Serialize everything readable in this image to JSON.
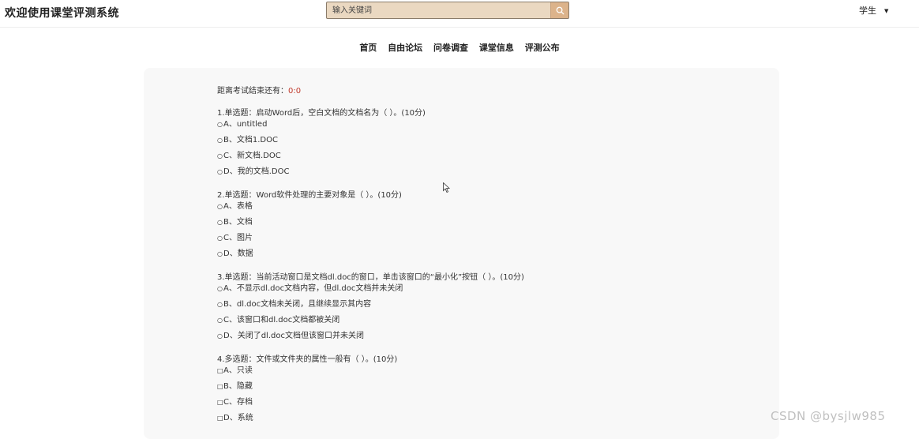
{
  "header": {
    "site_title": "欢迎使用课堂评测系统",
    "search": {
      "placeholder": "输入关键词",
      "icon": "search-icon"
    },
    "user_menu": {
      "label": "学生",
      "icon": "caret-down-icon"
    }
  },
  "nav": {
    "items": [
      {
        "label": "首页"
      },
      {
        "label": "自由论坛"
      },
      {
        "label": "问卷调查"
      },
      {
        "label": "课堂信息"
      },
      {
        "label": "评测公布"
      }
    ]
  },
  "exam": {
    "timer_label": "距离考试结束还有：",
    "timer_value": "0:0",
    "questions": [
      {
        "title": "1.单选题：启动Word后，空白文档的文档名为（      ）。(10分)",
        "type": "radio",
        "options": [
          "A、untitled",
          "B、文档1.DOC",
          "C、新文档.DOC",
          "D、我的文档.DOC"
        ]
      },
      {
        "title": "2.单选题：Word软件处理的主要对象是（      ）。(10分)",
        "type": "radio",
        "options": [
          "A、表格",
          "B、文档",
          "C、图片",
          "D、数据"
        ]
      },
      {
        "title": "3.单选题：当前活动窗口是文档dl.doc的窗口，单击该窗口的“最小化”按钮（      ）。(10分)",
        "type": "radio",
        "options": [
          "A、不显示dl.doc文档内容，但dl.doc文档并未关闭",
          "B、dl.doc文档未关闭，且继续显示其内容",
          "C、该窗口和dl.doc文档都被关闭",
          "D、关闭了dl.doc文档但该窗口并未关闭"
        ]
      },
      {
        "title": "4.多选题：文件或文件夹的属性一般有（      ）。(10分)",
        "type": "checkbox",
        "options": [
          "A、只读",
          "B、隐藏",
          "C、存档",
          "D、系统"
        ]
      }
    ]
  },
  "watermark": "CSDN @bysjlw985",
  "colors": {
    "search_bg": "#ead8c1",
    "search_button": "#dcb38b",
    "timer": "#c0392b",
    "panel": "#f8f8f8"
  }
}
